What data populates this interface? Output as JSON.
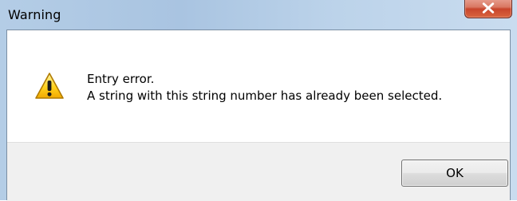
{
  "window": {
    "title": "Warning",
    "colors": {
      "frame": "#b4cde6",
      "close_button": "#c8452c",
      "footer": "#f0f0f0",
      "content": "#ffffff"
    }
  },
  "titlebar": {
    "close_icon": "close-icon"
  },
  "message": {
    "icon": "warning-icon",
    "line1": "Entry error.",
    "line2": "A string with this string number has already been selected."
  },
  "buttons": {
    "ok_label": "OK"
  }
}
